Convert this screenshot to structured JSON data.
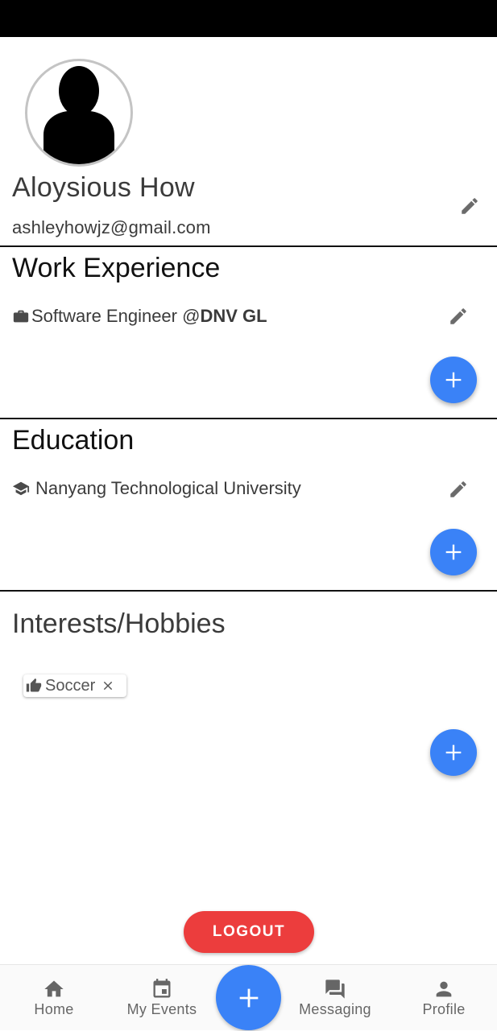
{
  "profile": {
    "name": "Aloysious How",
    "email": "ashleyhowjz@gmail.com"
  },
  "work_experience": {
    "title": "Work Experience",
    "items": [
      {
        "role": "Software Engineer @ ",
        "company": "DNV GL"
      }
    ]
  },
  "education": {
    "title": "Education",
    "items": [
      {
        "school": "Nanyang Technological University"
      }
    ]
  },
  "interests": {
    "title": "Interests/Hobbies",
    "chips": [
      {
        "label": "Soccer"
      }
    ]
  },
  "logout_label": "LOGOUT",
  "nav": {
    "items": [
      {
        "label": "Home",
        "icon": "home-icon"
      },
      {
        "label": "My Events",
        "icon": "calendar-icon"
      },
      {
        "label": "Messaging",
        "icon": "chat-icon"
      },
      {
        "label": "Profile",
        "icon": "person-icon"
      }
    ]
  },
  "colors": {
    "accent": "#3a82f7",
    "danger": "#ec3d3d",
    "status_bar": "#000000"
  }
}
